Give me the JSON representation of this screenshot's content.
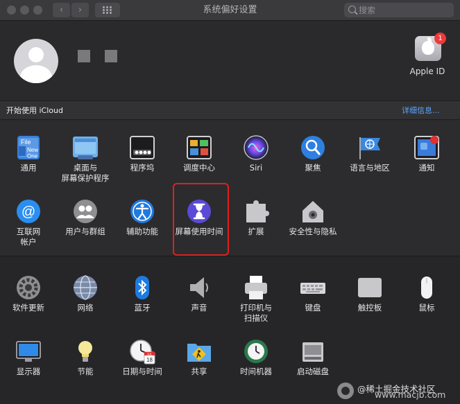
{
  "window": {
    "title": "系统偏好设置"
  },
  "search": {
    "placeholder": "搜索"
  },
  "account": {
    "apple_id_label": "Apple ID",
    "apple_id_badge": "1",
    "icloud_prompt": "开始使用 iCloud",
    "details_link": "详细信息..."
  },
  "panes_row1": [
    {
      "label": "通用",
      "icon": "general-icon"
    },
    {
      "label": "桌面与\n屏幕保护程序",
      "icon": "desktop-screensaver-icon"
    },
    {
      "label": "程序坞",
      "icon": "dock-icon"
    },
    {
      "label": "调度中心",
      "icon": "mission-control-icon"
    },
    {
      "label": "Siri",
      "icon": "siri-icon"
    },
    {
      "label": "聚焦",
      "icon": "spotlight-icon"
    },
    {
      "label": "语言与地区",
      "icon": "language-region-icon"
    },
    {
      "label": "通知",
      "icon": "notifications-icon"
    }
  ],
  "panes_row2": [
    {
      "label": "互联网\n帐户",
      "icon": "internet-accounts-icon"
    },
    {
      "label": "用户与群组",
      "icon": "users-groups-icon"
    },
    {
      "label": "辅助功能",
      "icon": "accessibility-icon"
    },
    {
      "label": "屏幕使用时间",
      "icon": "screen-time-icon"
    },
    {
      "label": "扩展",
      "icon": "extensions-icon"
    },
    {
      "label": "安全性与隐私",
      "icon": "security-privacy-icon"
    }
  ],
  "panes_row3": [
    {
      "label": "软件更新",
      "icon": "software-update-icon"
    },
    {
      "label": "网络",
      "icon": "network-icon"
    },
    {
      "label": "蓝牙",
      "icon": "bluetooth-icon"
    },
    {
      "label": "声音",
      "icon": "sound-icon"
    },
    {
      "label": "打印机与\n扫描仪",
      "icon": "printer-scanner-icon"
    },
    {
      "label": "键盘",
      "icon": "keyboard-icon"
    },
    {
      "label": "触控板",
      "icon": "trackpad-icon"
    },
    {
      "label": "鼠标",
      "icon": "mouse-icon"
    }
  ],
  "panes_row4": [
    {
      "label": "显示器",
      "icon": "displays-icon"
    },
    {
      "label": "节能",
      "icon": "energy-saver-icon"
    },
    {
      "label": "日期与时间",
      "icon": "date-time-icon"
    },
    {
      "label": "共享",
      "icon": "sharing-icon"
    },
    {
      "label": "时间机器",
      "icon": "time-machine-icon"
    },
    {
      "label": "启动磁盘",
      "icon": "startup-disk-icon"
    }
  ],
  "date_icon": {
    "month": "JUL",
    "day": "18"
  },
  "watermark": {
    "line1": "@稀土掘金技术社区",
    "line2": "www.macjb.com"
  },
  "colors": {
    "highlight": "#e0201c",
    "link": "#5aa7ff",
    "badge": "#ee3a3a"
  }
}
